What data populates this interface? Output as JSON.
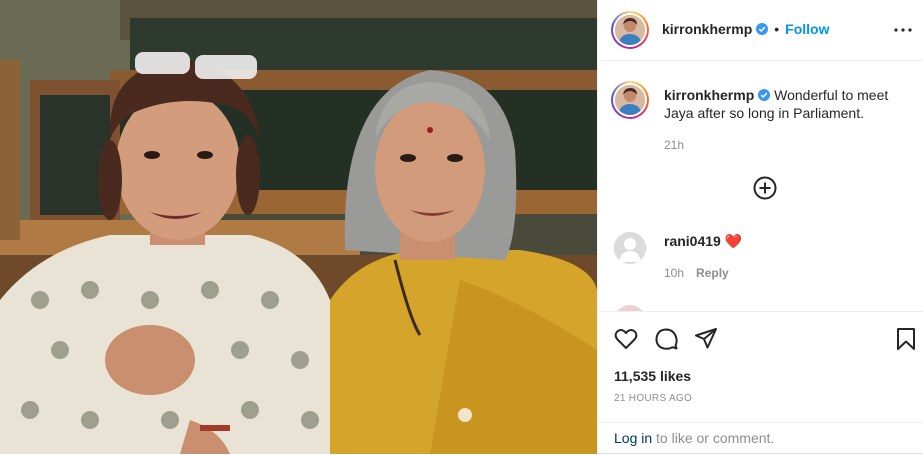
{
  "post": {
    "author": {
      "username": "kirronkhermp",
      "verified": true,
      "avatar_icon": "profile-photo"
    },
    "follow_label": "Follow",
    "separator": "•",
    "more_icon": "more-horizontal-icon",
    "caption": {
      "username": "kirronkhermp",
      "text": "Wonderful to meet Jaya after so long in Parliament.",
      "age": "21h"
    },
    "load_more_icon": "plus-circle-icon",
    "comments": [
      {
        "username": "rani0419",
        "text": "❤️",
        "age": "10h",
        "reply_label": "Reply"
      }
    ],
    "actions": {
      "like_icon": "heart-icon",
      "comment_icon": "comment-icon",
      "share_icon": "paper-plane-icon",
      "save_icon": "bookmark-icon"
    },
    "likes": "11,535 likes",
    "timestamp": "21 HOURS AGO",
    "login_prompt": {
      "link": "Log in",
      "rest": " to like or comment."
    },
    "accent_color": "#0095f6",
    "verified_color": "#3897f0"
  }
}
